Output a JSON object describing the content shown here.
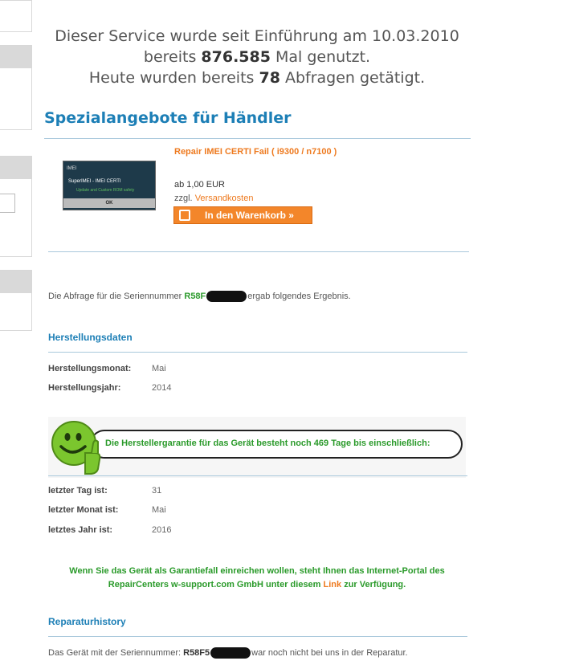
{
  "stats": {
    "line1": "Dieser Service wurde seit Einführung am 10.03.2010",
    "line2_prefix": "bereits ",
    "line2_count": "876.585",
    "line2_suffix": " Mal genutzt.",
    "line3_prefix": "Heute wurden bereits ",
    "line3_count": "78",
    "line3_suffix": " Abfragen getätigt."
  },
  "special_offers": {
    "heading": "Spezialangebote für Händler",
    "product": {
      "thumb_title": "IMEI",
      "thumb_line": "SuperIMEI - IMEI CERTI",
      "thumb_sub": "Update and Custom ROM safety",
      "thumb_button": "OK",
      "name": "Repair IMEI CERTI Fail ( i9300 / n7100 )",
      "price": "ab 1,00 EUR",
      "shipping_prefix": "zzgl. ",
      "shipping_link": "Versandkosten",
      "cart_button": "In den Warenkorb »"
    }
  },
  "query": {
    "prefix": "Die Abfrage für die Seriennummer ",
    "serial": "R58F",
    "suffix": "ergab folgendes Ergebnis."
  },
  "manufacturing": {
    "heading": "Herstellungsdaten",
    "rows": [
      {
        "label": "Herstellungsmonat:",
        "value": "Mai"
      },
      {
        "label": "Herstellungsjahr:",
        "value": "2014"
      }
    ]
  },
  "warranty": {
    "message": "Die Herstellergarantie für das Gerät besteht noch 469 Tage bis einschließlich:",
    "rows": [
      {
        "label": "letzter Tag ist:",
        "value": "31"
      },
      {
        "label": "letzter Monat ist:",
        "value": "Mai"
      },
      {
        "label": "letztes Jahr ist:",
        "value": "2016"
      }
    ]
  },
  "portal": {
    "line1": "Wenn Sie das Gerät als Garantiefall einreichen wollen, steht Ihnen das Internet-Portal des",
    "line2_prefix": "RepairCenters w-support.com GmbH unter diesem ",
    "link": "Link",
    "line2_suffix": " zur Verfügung."
  },
  "repair_history": {
    "heading": "Reparaturhistory",
    "prefix": "Das Gerät mit der Seriennummer: ",
    "serial": "R58F5",
    "suffix": "war noch nicht bei uns in der Reparatur."
  },
  "colors": {
    "heading_blue": "#1d7fb6",
    "accent_orange": "#ee7a1f",
    "status_green": "#2a9a2a",
    "smiley_green": "#7bc62e"
  },
  "icons": {
    "cart": "cart-icon",
    "smiley": "smiley-thumbs-up-icon"
  }
}
